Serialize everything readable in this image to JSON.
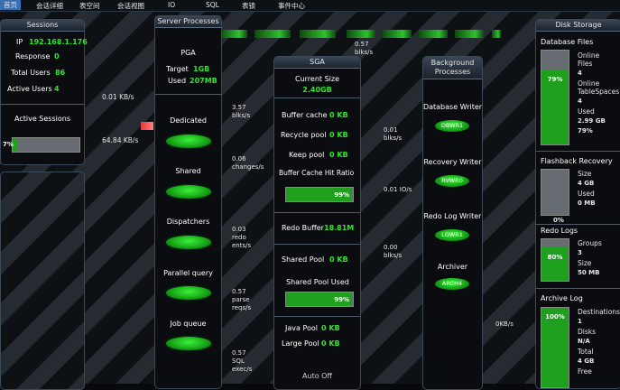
{
  "menu": [
    "首页",
    "会话详细",
    "表空间",
    "会话视图",
    "IO",
    "SQL",
    "表锁",
    "事件中心"
  ],
  "sessions": {
    "title": "Sessions",
    "ip_label": "IP",
    "ip": "192.168.1.176",
    "response_label": "Response",
    "response": "0",
    "total_label": "Total Users",
    "total": "86",
    "active_label": "Active Users",
    "active": "4",
    "active_sessions_title": "Active Sessions",
    "active_pct": "7%",
    "active_fraction": 0.07
  },
  "flows": {
    "net1": "0.01 KB/s",
    "net2": "64.84 KB/s",
    "top": "0.57\nblks/s",
    "sp1": "3.57\nblks/s",
    "sp2": "0.06\nchanges/s",
    "sp3": "0.03\nredo\nents/s",
    "sp4": "0.57\nparse\nreqs/s",
    "sp5": "0.57\nSQL\nexec/s",
    "bg1": "0.01\nblks/s",
    "bg2": "0.01 IO/s",
    "bg3": "0.00\nblks/s",
    "bg4": "0KB/s"
  },
  "server_processes": {
    "title": "Server Processes",
    "pga_title": "PGA",
    "target_label": "Target",
    "target": "1GB",
    "used_label": "Used",
    "used": "207MB",
    "dedicated": "Dedicated",
    "shared": "Shared",
    "dispatchers": "Dispatchers",
    "parallel": "Parallel query",
    "job": "Job queue"
  },
  "sga": {
    "title": "SGA",
    "current_label": "Current Size",
    "current": "2.40GB",
    "buffer_cache_label": "Buffer cache",
    "buffer_cache": "0 KB",
    "recycle_label": "Recycle pool",
    "recycle": "0 KB",
    "keep_label": "Keep pool",
    "keep": "0 KB",
    "hit_ratio_label": "Buffer Cache Hit Ratio",
    "hit_ratio": "99%",
    "hit_ratio_fraction": 0.99,
    "redo_label": "Redo Buffer",
    "redo": "18.81M",
    "shared_pool_label": "Shared Pool",
    "shared_pool": "0 KB",
    "shared_used_label": "Shared Pool Used",
    "shared_used": "99%",
    "shared_used_fraction": 0.99,
    "java_label": "Java Pool",
    "java": "0 KB",
    "large_label": "Large Pool",
    "large": "0 KB",
    "auto": "Auto Off"
  },
  "background": {
    "title": "Background\nProcesses",
    "dbw_label": "Database Writer",
    "dbw": "DBWR1",
    "rec_label": "Recovery Writer",
    "rec": "RVWR0",
    "redo_label": "Redo Log Writer",
    "redo": "LGWR1",
    "arch_label": "Archiver",
    "arch": "ARCH4"
  },
  "disk": {
    "title": "Disk Storage",
    "dbfiles_title": "Database Files",
    "online_files_label": "Online\nFiles",
    "online_files": "4",
    "online_ts_label": "Online\nTableSpaces",
    "online_ts": "4",
    "used_label": "Used",
    "used": "2.99 GB",
    "used_pct": "79%",
    "used_fraction": 0.79,
    "flashback_title": "Flashback Recovery",
    "fb_size_label": "Size",
    "fb_size": "4 GB",
    "fb_used_label": "Used",
    "fb_used": "0 MB",
    "fb_pct": "0%",
    "fb_fraction": 0.0,
    "redo_title": "Redo Logs",
    "groups_label": "Groups",
    "groups": "3",
    "redo_size_label": "Size",
    "redo_size": "50 MB",
    "redo_pct": "80%",
    "redo_fraction": 0.8,
    "archive_title": "Archive Log",
    "dest_label": "Destinations",
    "dest": "1",
    "disks_label": "Disks",
    "disks": "N/A",
    "total_label": "Total",
    "total": "4 GB",
    "free_label": "Free",
    "arch_pct": "100%",
    "arch_fraction": 1.0
  }
}
